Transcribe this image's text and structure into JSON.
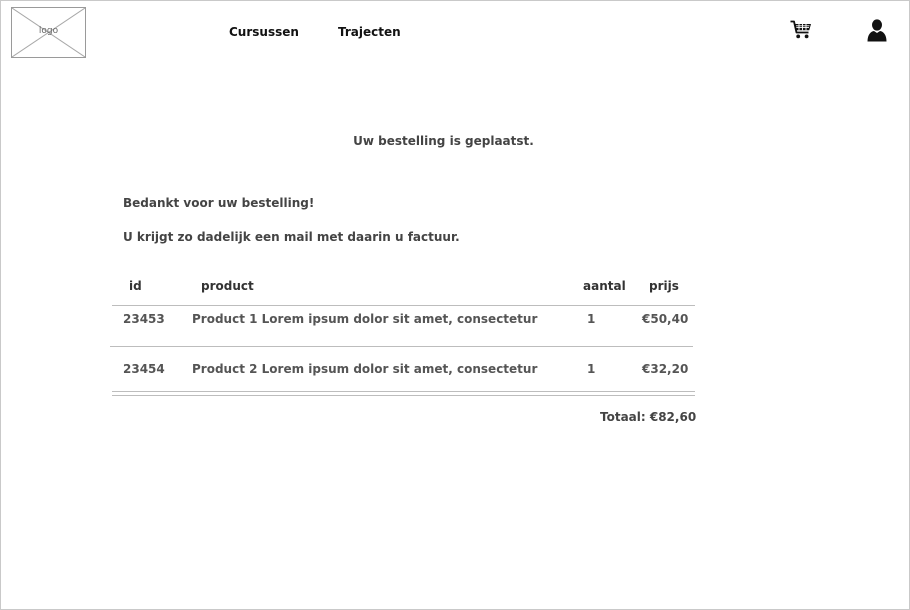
{
  "header": {
    "logo_text": "logo",
    "nav": [
      {
        "label": "Cursussen"
      },
      {
        "label": "Trajecten"
      }
    ],
    "icons": [
      "cart-icon",
      "user-icon"
    ]
  },
  "confirmation": {
    "heading": "Uw bestelling is geplaatst.",
    "thanks": "Bedankt voor uw bestelling!",
    "mail_notice": "U krijgt zo dadelijk een mail met daarin u factuur."
  },
  "order_table": {
    "columns": [
      "id",
      "product",
      "aantal",
      "prijs"
    ],
    "rows": [
      {
        "id": "23453",
        "product": "Product 1 Lorem ipsum dolor sit amet, consectetur",
        "qty": "1",
        "price": "€50,40"
      },
      {
        "id": "23454",
        "product": "Product 2 Lorem ipsum dolor sit amet, consectetur",
        "qty": "1",
        "price": "€32,20"
      }
    ],
    "total": "Totaal: €82,60"
  }
}
